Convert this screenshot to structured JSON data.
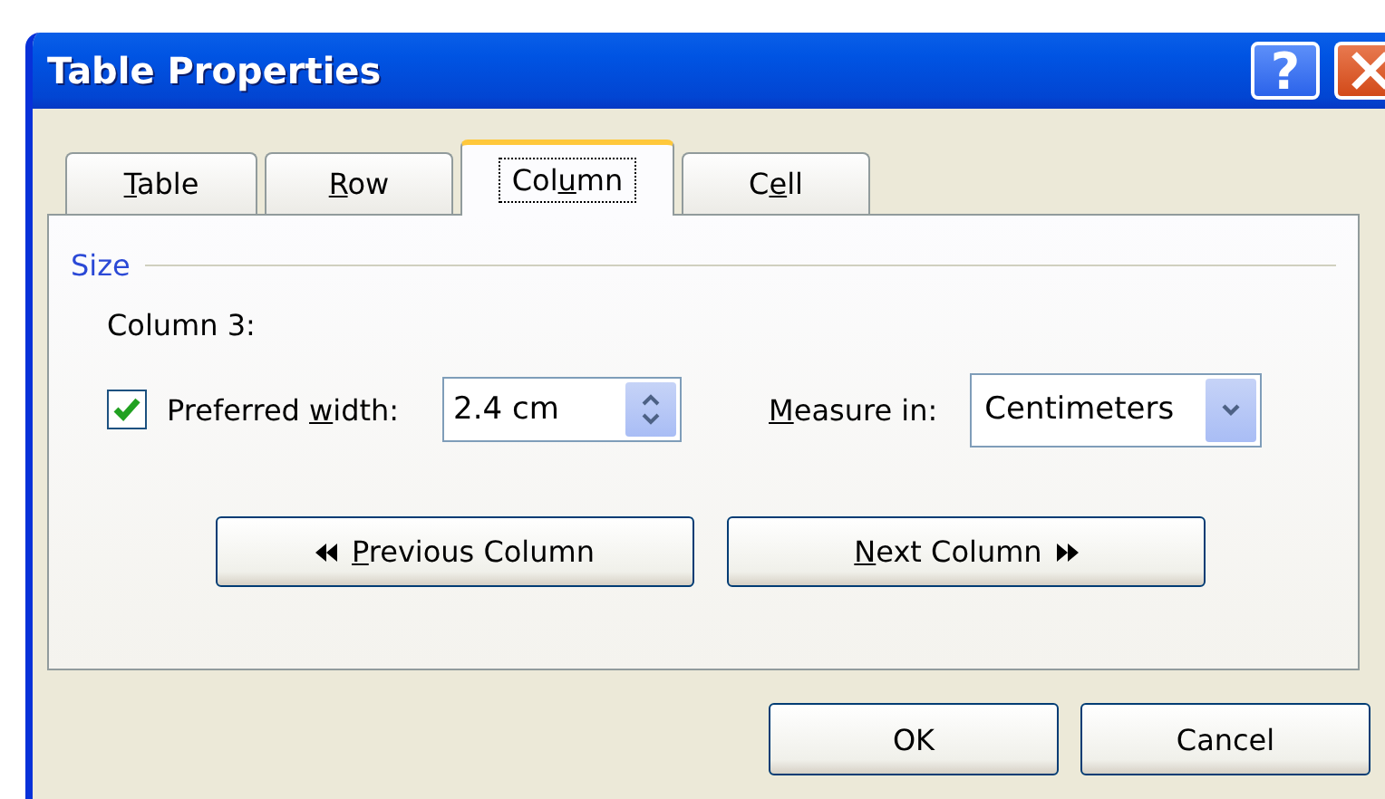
{
  "window": {
    "title": "Table Properties",
    "help_label": "?"
  },
  "tabs": [
    {
      "label": {
        "key": "T",
        "after": "able"
      },
      "selected": false
    },
    {
      "label": {
        "key": "R",
        "after": "ow"
      },
      "selected": false
    },
    {
      "label": {
        "before": "Col",
        "key": "u",
        "after": "mn"
      },
      "selected": true
    },
    {
      "label": {
        "before": "C",
        "key": "e",
        "after": "ll"
      },
      "selected": false
    }
  ],
  "size_group": {
    "title": "Size",
    "subject": "Column 3:",
    "preferred_width": {
      "checked": true,
      "label": {
        "before": "Preferred ",
        "key": "w",
        "after": "idth:"
      },
      "value": "2.4 cm"
    },
    "measure_in": {
      "label": {
        "key": "M",
        "after": "easure in:"
      },
      "value": "Centimeters"
    },
    "nav_buttons": [
      {
        "kind": "previous",
        "label": {
          "key": "P",
          "after": "revious Column"
        }
      },
      {
        "kind": "next",
        "label": {
          "key": "N",
          "after": "ext Column"
        }
      }
    ]
  },
  "buttons": [
    {
      "label": "OK"
    },
    {
      "label": "Cancel"
    }
  ]
}
